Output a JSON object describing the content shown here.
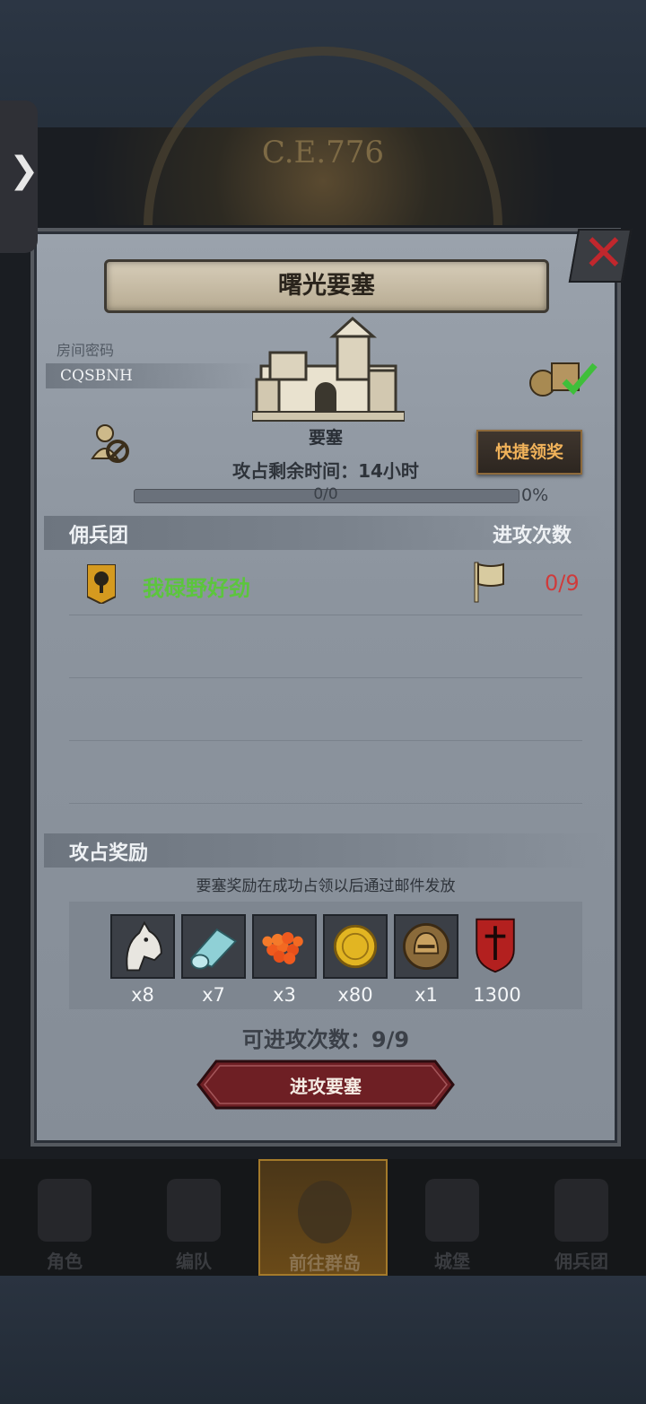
{
  "background": {
    "era_text": "C.E.776"
  },
  "side_tab": {
    "glyph": "❯"
  },
  "dialog": {
    "title": "曙光要塞",
    "room_label": "房间密码",
    "room_code": "CQSBNH",
    "fortress_name": "要塞",
    "quick_claim_label": "快捷领奖",
    "remaining_time": "攻占剩余时间：14小时",
    "progress_text": "0/0",
    "progress_percent": "0%",
    "progress_value": 0,
    "mercenary_header": "佣兵团",
    "attack_count_header": "进攻次数",
    "guilds": [
      {
        "name": "我碌野好劲",
        "attacks": "0/9"
      }
    ],
    "rewards_header": "攻占奖励",
    "rewards_note": "要塞奖励在成功占领以后通过邮件发放",
    "rewards": [
      {
        "icon": "horse-icon",
        "qty": "x8"
      },
      {
        "icon": "cloth-roll-icon",
        "qty": "x7"
      },
      {
        "icon": "berries-icon",
        "qty": "x3"
      },
      {
        "icon": "gold-coin-icon",
        "qty": "x80"
      },
      {
        "icon": "helmet-coin-icon",
        "qty": "x1"
      },
      {
        "icon": "guild-crest-icon",
        "qty": "1300"
      }
    ],
    "remaining_attacks": "可进攻次数：9/9",
    "attack_button": "进攻要塞"
  },
  "nav": [
    {
      "label": "角色",
      "icon": "knight-icon"
    },
    {
      "label": "编队",
      "icon": "helmet-icon"
    },
    {
      "label": "前往群岛",
      "icon": "compass-icon",
      "active": true
    },
    {
      "label": "城堡",
      "icon": "castle-icon"
    },
    {
      "label": "佣兵团",
      "icon": "mercenary-icon"
    }
  ],
  "colors": {
    "guild_name": "#5cc53d",
    "attack_count": "#cf3b3b",
    "quick_claim_text": "#f0b25a",
    "close_x": "#c1272d"
  }
}
